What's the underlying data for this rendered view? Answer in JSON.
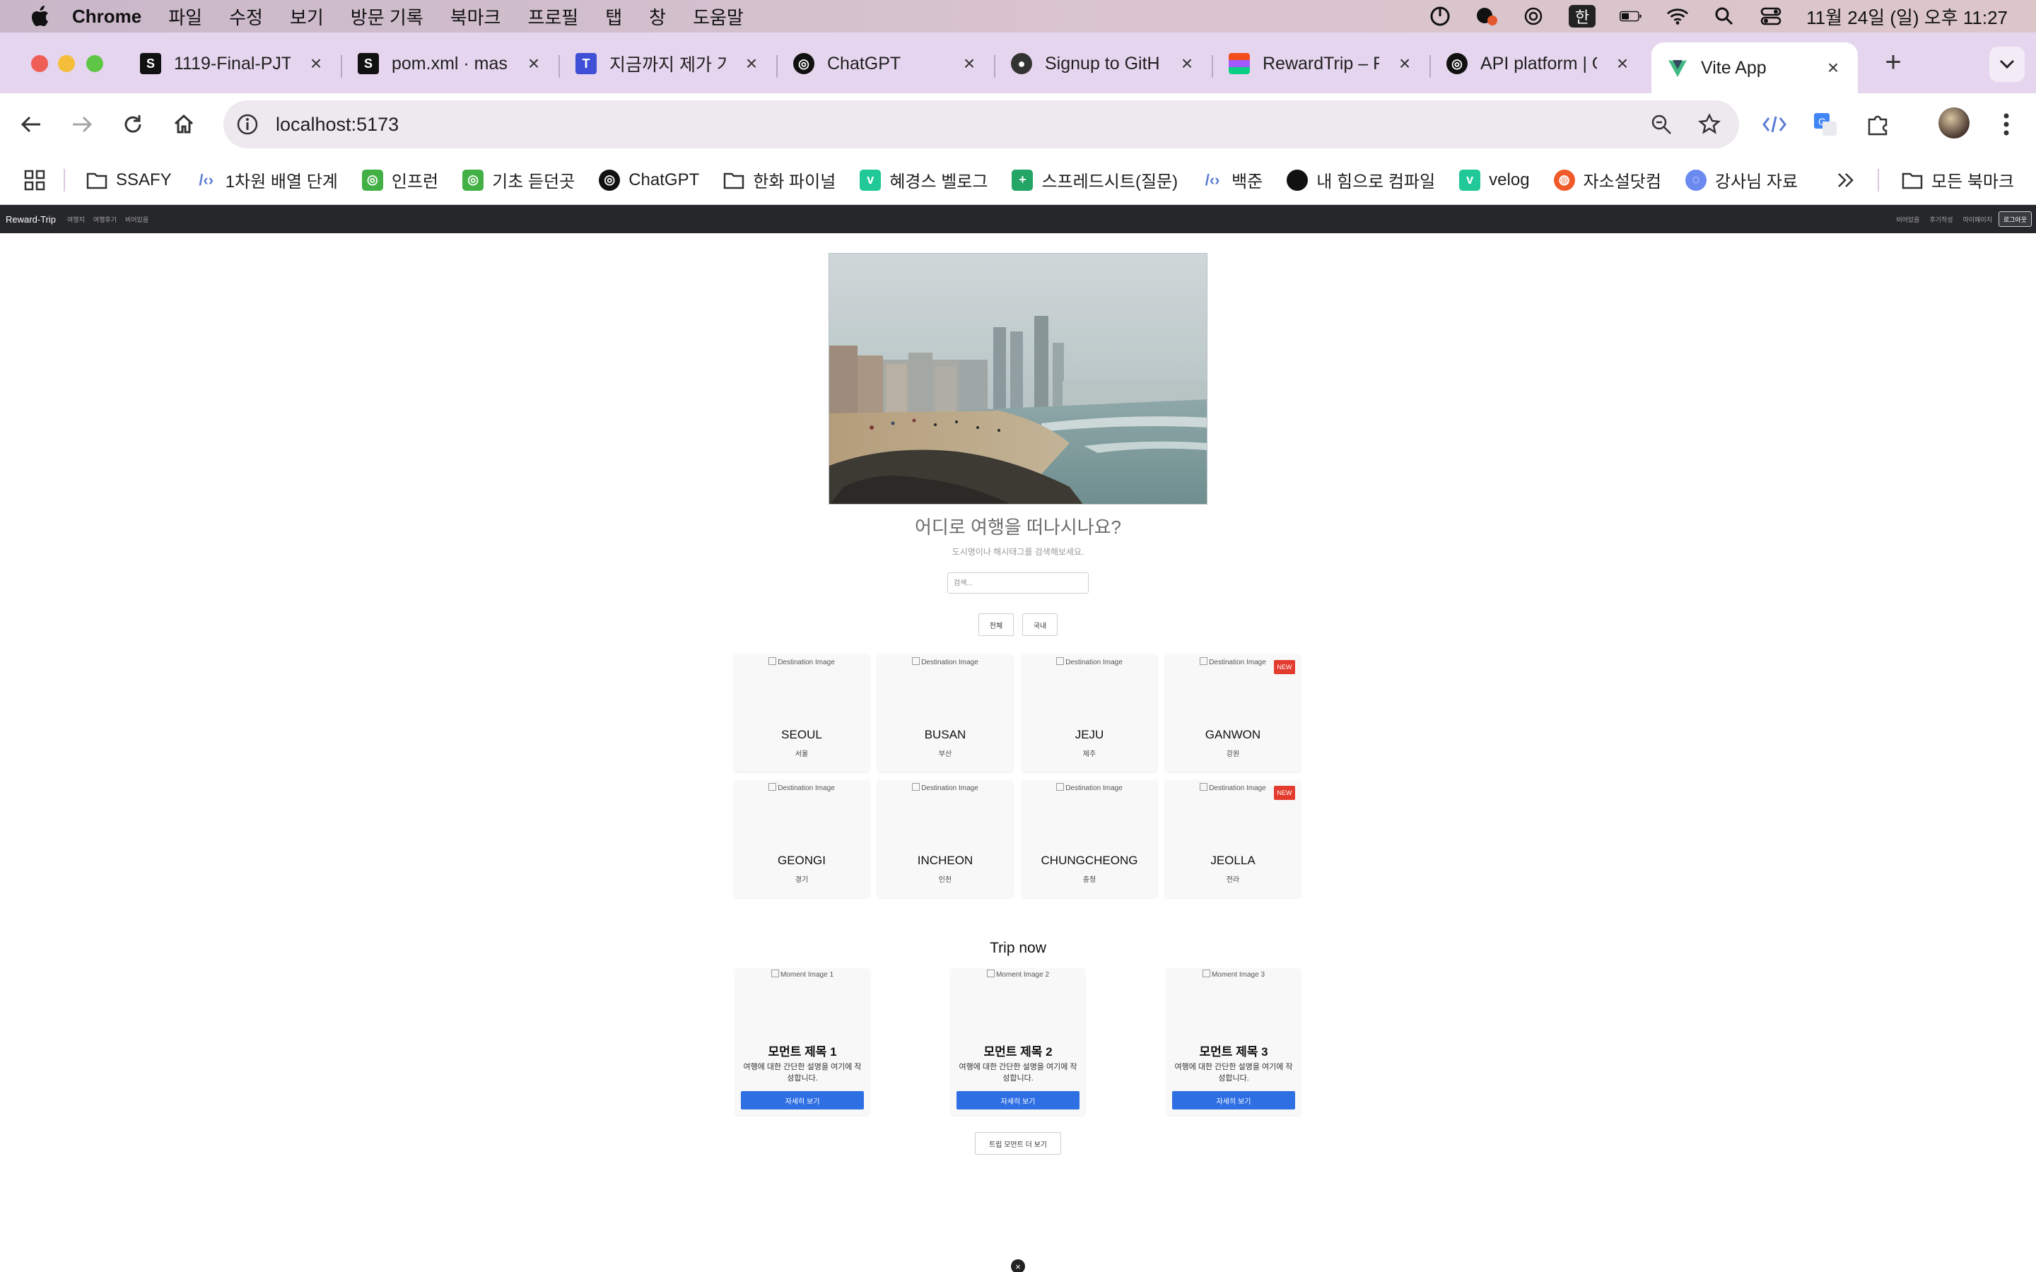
{
  "menubar": {
    "app_name": "Chrome",
    "items": [
      "파일",
      "수정",
      "보기",
      "방문 기록",
      "북마크",
      "프로필",
      "탭",
      "창",
      "도움말"
    ],
    "ime": "한",
    "datetime": "11월 24일 (일) 오후 11:27"
  },
  "tabs": [
    {
      "title": "1119-Final-PJT",
      "favicon": "notion-icon"
    },
    {
      "title": "pom.xml · mas",
      "favicon": "notion-icon"
    },
    {
      "title": "지금까지 제가 가",
      "favicon": "t-icon"
    },
    {
      "title": "ChatGPT",
      "favicon": "openai-icon"
    },
    {
      "title": "Signup to GitH",
      "favicon": "github-icon"
    },
    {
      "title": "RewardTrip – F",
      "favicon": "figma-icon"
    },
    {
      "title": "API platform | O",
      "favicon": "openai-icon"
    },
    {
      "title": "Vite App",
      "favicon": "vite-icon",
      "active": true
    }
  ],
  "toolbar": {
    "url": "localhost:5173"
  },
  "bookmarks": [
    {
      "label": "SSAFY",
      "icon": "folder-icon"
    },
    {
      "label": "1차원 배열 단계",
      "icon": "code-icon"
    },
    {
      "label": "인프런",
      "icon": "inflearn-icon"
    },
    {
      "label": "기초 듣던곳",
      "icon": "inflearn-icon"
    },
    {
      "label": "ChatGPT",
      "icon": "openai-icon"
    },
    {
      "label": "한화 파이널",
      "icon": "folder-icon"
    },
    {
      "label": "혜경스 벨로그",
      "icon": "velog-icon"
    },
    {
      "label": "스프레드시트(질문)",
      "icon": "sheets-icon"
    },
    {
      "label": "백준",
      "icon": "code-icon"
    },
    {
      "label": "내 힘으로 컴파일",
      "icon": "circle-icon"
    },
    {
      "label": "velog",
      "icon": "velog-icon"
    },
    {
      "label": "자소설닷컴",
      "icon": "jaso-icon"
    },
    {
      "label": "강사님 자료",
      "icon": "drive-icon"
    }
  ],
  "bookmarks_all": "모든 북마크",
  "app": {
    "brand": "Reward-Trip",
    "nav_links": [
      "여행지",
      "여행후기",
      "비어있음"
    ],
    "right_links": [
      "비어있음",
      "후기작성",
      "마이페이지"
    ],
    "logout": "로그아웃"
  },
  "hero": {
    "question": "어디로 여행을 떠나시나요?",
    "subtitle": "도시명이나 해시태그를 검색해보세요.",
    "search_placeholder": "검색..."
  },
  "filters": [
    "전체",
    "국내"
  ],
  "destinations": [
    {
      "alt": "Destination Image",
      "name": "SEOUL",
      "kname": "서울",
      "new": ""
    },
    {
      "alt": "Destination Image",
      "name": "BUSAN",
      "kname": "부산",
      "new": ""
    },
    {
      "alt": "Destination Image",
      "name": "JEJU",
      "kname": "제주",
      "new": ""
    },
    {
      "alt": "Destination Image",
      "name": "GANWON",
      "kname": "강원",
      "new": "NEW"
    },
    {
      "alt": "Destination Image",
      "name": "GEONGI",
      "kname": "경기",
      "new": ""
    },
    {
      "alt": "Destination Image",
      "name": "INCHEON",
      "kname": "인천",
      "new": ""
    },
    {
      "alt": "Destination Image",
      "name": "CHUNGCHEONG",
      "kname": "충청",
      "new": ""
    },
    {
      "alt": "Destination Image",
      "name": "JEOLLA",
      "kname": "전라",
      "new": "NEW"
    }
  ],
  "trip_now": {
    "title": "Trip now",
    "moments": [
      {
        "alt": "Moment Image 1",
        "title": "모먼트 제목 1",
        "desc": "여행에 대한 간단한 설명을 여기에 작성합니다.",
        "button": "자세히 보기"
      },
      {
        "alt": "Moment Image 2",
        "title": "모먼트 제목 2",
        "desc": "여행에 대한 간단한 설명을 여기에 작성합니다.",
        "button": "자세히 보기"
      },
      {
        "alt": "Moment Image 3",
        "title": "모먼트 제목 3",
        "desc": "여행에 대한 간단한 설명을 여기에 작성합니다.",
        "button": "자세히 보기"
      }
    ],
    "more_button": "트립 모먼트 더 보기"
  },
  "colors": {
    "tabstrip": "#e6d5ee",
    "app_nav": "#26272b",
    "primary_button": "#2f6fe4",
    "new_badge": "#e33b2e"
  }
}
